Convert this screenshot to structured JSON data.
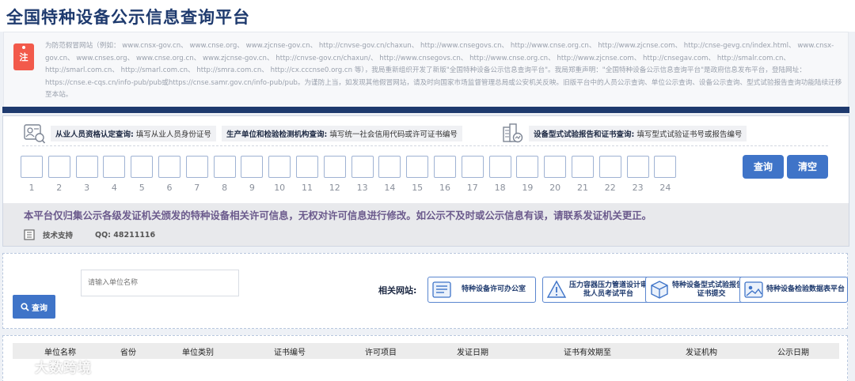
{
  "header": {
    "title": "全国特种设备公示信息查询平台"
  },
  "notice": {
    "badge": "注",
    "text": "为防范假冒网站（例如：  www.cnsx-gov.cn、  www.cnse.org、  www.zjcnse-gov.cn、  http://cnvse-gov.cn/chaxun、  http://www.cnsegovs.cn、  http://www.cnse.org.cn、  http://www.zjcnse.com、  http://cnse-gevg.cn/index.html、  www.cnsx-gov.cn、  www.cnses.org、  www.cnse.org.cn、  www.zjcnse-gov.cn、  http://cnvse-gov.cn/chaxun/、  http://www.cnsegovs.cn、  http://www.cnse.org.cn、  http://www.zjcnse.com、  http://cnsegav.com、  http://smalr.com.cn、  http://smarl.com.cn、  http://smarl.com.cn、  http://smra.com.cn、  http://cx.cccnse0.org.cn 等），我局重新组织开发了新版\"全国特种设备公示信息查询平台\"。我局郑重声明：\"全国特种设备公示信息查询平台\"是政府信息发布平台，登陆网址：  https://cnse.e-cqs.cn/info-pub/pub或https://cnse.samr.gov.cn/info-pub/pub。为谨防上当，如发现其他假冒网站，请及时向国家市场监督管理总局或公安机关反映。旧版平台中的人员公示查询、单位公示查询、设备公示查询、型式试验报告查询功能陆续迁移至本站。"
  },
  "categories": [
    {
      "title": "从业人员资格认定查询:",
      "hint": "填写从业人员身份证号",
      "icon": "person-card-icon"
    },
    {
      "title": "生产单位和检验检测机构查询:",
      "hint": "填写统一社会信用代码或许可证书编号",
      "icon": "none"
    },
    {
      "title": "设备型式试验报告和证书查询:",
      "hint": "填写型式试验证书号或报告编号",
      "icon": "building-chart-icon"
    }
  ],
  "code_digits": [
    "1",
    "2",
    "3",
    "4",
    "5",
    "6",
    "7",
    "8",
    "9",
    "10",
    "11",
    "12",
    "13",
    "14",
    "15",
    "16",
    "17",
    "18",
    "19",
    "20",
    "21",
    "22",
    "23",
    "24"
  ],
  "buttons": {
    "query": "查询",
    "clear": "清空"
  },
  "disclaimer": "本平台仅归集公示各级发证机关颁发的特种设备相关许可信息，无权对许可信息进行修改。如公示不及时或公示信息有误，请联系发证机关更正。",
  "support": {
    "label": "技术支持",
    "qq": "QQ:  48211116"
  },
  "unit_search": {
    "placeholder": "请输入单位名称",
    "button": "查询"
  },
  "related": {
    "label": "相关网站:",
    "links": [
      {
        "text": "特种设备许可办公室",
        "icon": "document-list-icon"
      },
      {
        "text": "压力容器压力管道设计审批人员考试平台",
        "icon": "triangle-warning-icon"
      },
      {
        "text": "特种设备型式试验报告和证书提交",
        "icon": "cube-icon"
      },
      {
        "text": "特种设备检验数据表平台",
        "icon": "image-window-icon"
      }
    ]
  },
  "table": {
    "columns": [
      "单位名称",
      "省份",
      "单位类别",
      "证书编号",
      "许可项目",
      "发证日期",
      "证书有效期至",
      "发证机构",
      "公示日期"
    ]
  },
  "watermark": "大数跨境",
  "colors": {
    "brand": "#1e3a6e",
    "button": "#3f74c8",
    "badge": "#f25a4b",
    "disclaimer": "#6b5a8c"
  }
}
